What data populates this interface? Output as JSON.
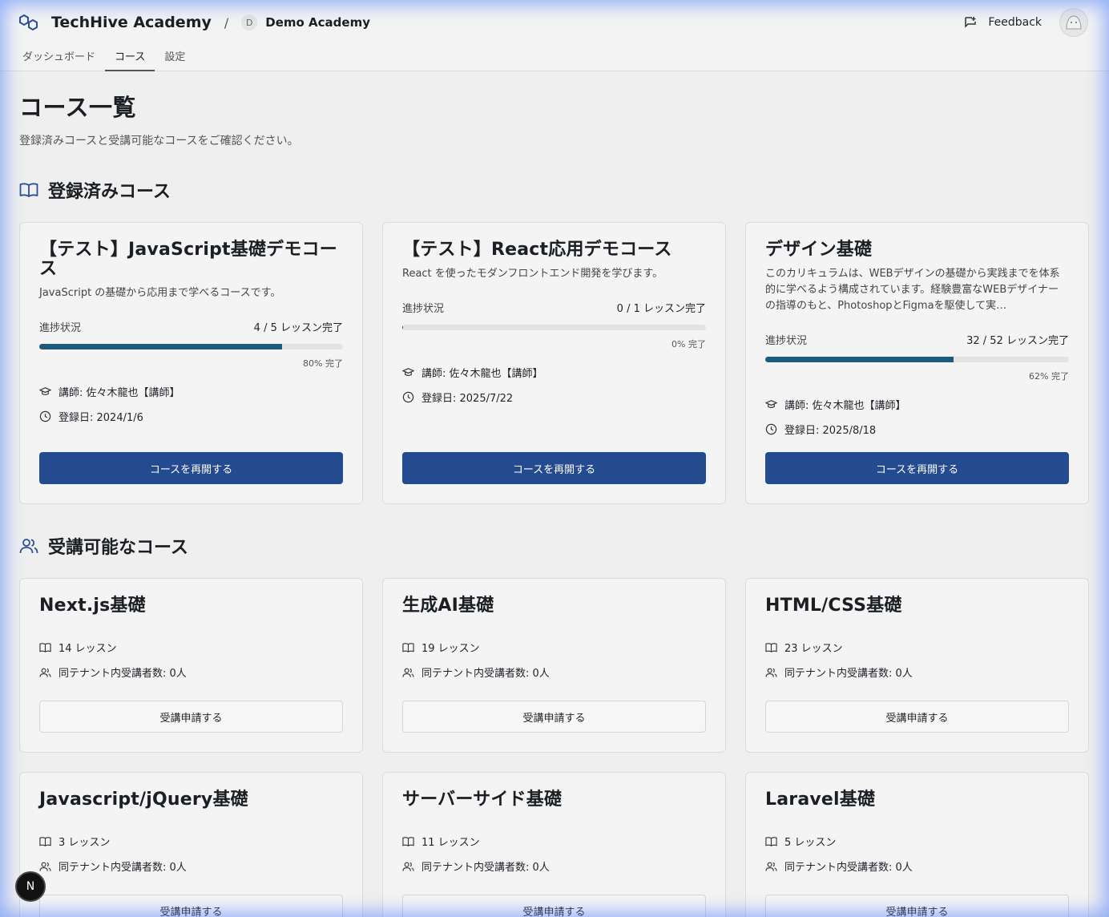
{
  "header": {
    "app_name": "TechHive Academy",
    "separator": "/",
    "org_initial": "D",
    "org_name": "Demo Academy",
    "feedback_label": "Feedback",
    "tabs": [
      "ダッシュボード",
      "コース",
      "設定"
    ],
    "active_tab": "コース"
  },
  "page": {
    "title": "コース一覧",
    "subtitle": "登録済みコースと受講可能なコースをご確認ください。"
  },
  "enrolled": {
    "title": "登録済みコース",
    "progress_label": "進捗状況",
    "button_label": "コースを再開する",
    "courses": [
      {
        "title": "【テスト】JavaScript基礎デモコース",
        "description": "JavaScript の基礎から応用まで学べるコースです。",
        "progress_text": "4 / 5 レッスン完了",
        "progress_pct": 80,
        "pct_text": "80% 完了",
        "instructor": "講師: 佐々木龍也【講師】",
        "enrolled_date": "登録日: 2024/1/6"
      },
      {
        "title": "【テスト】React応用デモコース",
        "description": "React を使ったモダンフロントエンド開発を学びます。",
        "progress_text": "0 / 1 レッスン完了",
        "progress_pct": 0,
        "pct_text": "0% 完了",
        "instructor": "講師: 佐々木龍也【講師】",
        "enrolled_date": "登録日: 2025/7/22"
      },
      {
        "title": "デザイン基礎",
        "description": "このカリキュラムは、WEBデザインの基礎から実践までを体系的に学べるよう構成されています。経験豊富なWEBデザイナーの指導のもと、PhotoshopとFigmaを駆使して実…",
        "progress_text": "32 / 52 レッスン完了",
        "progress_pct": 62,
        "pct_text": "62% 完了",
        "instructor": "講師: 佐々木龍也【講師】",
        "enrolled_date": "登録日: 2025/8/18"
      }
    ]
  },
  "available": {
    "title": "受講可能なコース",
    "button_label": "受講申請する",
    "courses": [
      {
        "title": "Next.js基礎",
        "lessons": "14 レッスン",
        "learners": "同テナント内受講者数: 0人"
      },
      {
        "title": "生成AI基礎",
        "lessons": "19 レッスン",
        "learners": "同テナント内受講者数: 0人"
      },
      {
        "title": "HTML/CSS基礎",
        "lessons": "23 レッスン",
        "learners": "同テナント内受講者数: 0人"
      },
      {
        "title": "Javascript/jQuery基礎",
        "lessons": "3 レッスン",
        "learners": "同テナント内受講者数: 0人"
      },
      {
        "title": "サーバーサイド基礎",
        "lessons": "11 レッスン",
        "learners": "同テナント内受講者数: 0人"
      },
      {
        "title": "Laravel基礎",
        "lessons": "5 レッスン",
        "learners": "同テナント内受講者数: 0人"
      }
    ]
  },
  "dev_badge": "N",
  "colors": {
    "primary_button": "#244a8f",
    "progress_fill": "#1d5b7c",
    "icon_accent": "#2b4f9a"
  }
}
